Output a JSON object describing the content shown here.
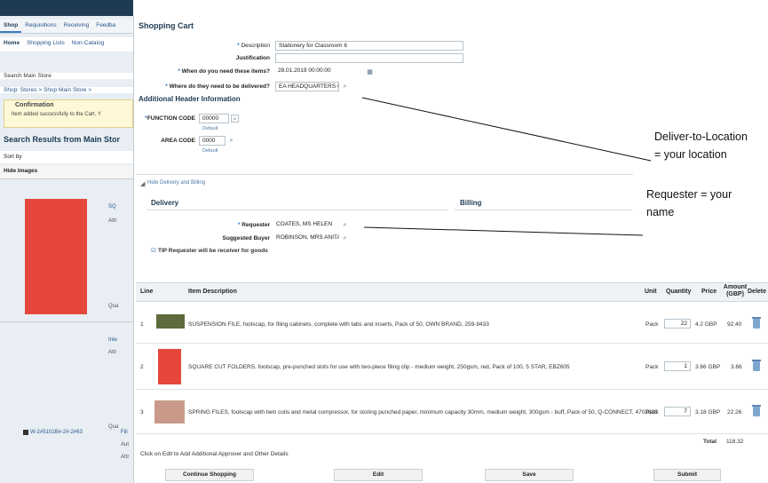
{
  "background": {
    "tabs": [
      "Shop",
      "Requisitions",
      "Receiving",
      "Feedba"
    ],
    "subtabs": [
      "Home",
      "Shopping Lists",
      "Non-Catalog"
    ],
    "search_line": "Search   Main Store",
    "breadcrumb": "Shop: Stores >  Shop Main Store >",
    "confirmation_title": "Confirmation",
    "confirmation_msg": "Item added successfully to the Cart. Y",
    "search_results_title": "Search Results from Main Stor",
    "sort_label": "Sort by",
    "hide_images": "Hide Images",
    "product_text_1": "SQ",
    "product_text_2": "Attr",
    "qual_1": "Qua",
    "product2_text_1": "Inte",
    "product2_text_2": "Attr",
    "qual_2": "Qua",
    "bottom_item": "W-2#5101B#-2#-2#63",
    "bottom_side_1": "Fili",
    "bottom_side_2": "Aut",
    "bottom_side_3": "Attr"
  },
  "cart": {
    "title": "Shopping Cart",
    "description_label": "Description",
    "description_value": "Stationery for Classroom 6",
    "justification_label": "Justification",
    "justification_value": "",
    "need_label": "When do you need these items?",
    "need_value": "28.01.2019 00:00:00",
    "deliver_label": "Where do they need to be delivered?",
    "deliver_value": "EA HEADQUARTERS QI",
    "additional_header": "Additional Header Information",
    "function_code_label": "FUNCTION CODE",
    "function_code_value": "00000",
    "function_default": "Default",
    "area_code_label": "AREA CODE",
    "area_code_value": "0000",
    "area_default": "Default",
    "hide_delivery_link": "Hide Delivery and Billing",
    "delivery_title": "Delivery",
    "billing_title": "Billing",
    "requester_label": "Requester",
    "requester_value": "COATES, MS HELEN",
    "buyer_label": "Suggested Buyer",
    "buyer_value": "ROBINSON, MRS ANITA",
    "tip_text": "TIP Requester will be receiver for goods"
  },
  "table": {
    "headers": {
      "line": "Line",
      "desc": "Item Description",
      "unit": "Unit",
      "qty": "Quantity",
      "price": "Price",
      "amount": "Amount (GBP)",
      "delete": "Delete"
    },
    "rows": [
      {
        "line": "1",
        "desc": "SUSPENSION FILE, foolscap, for filing cabinets, complete with tabs and inserts, Pack of 50, OWN BRAND, 259-9433",
        "unit": "Pack",
        "qty": "22",
        "price": "4.2 GBP",
        "amount": "92.40",
        "thumb_color": "#5d6b3c"
      },
      {
        "line": "2",
        "desc": "SQUARE CUT FOLDERS, foolscap, pre-punched slots for use with two-piece filing clip - medium weight, 250gsm, red, Pack of 100, 5 STAR, EBZ605",
        "unit": "Pack",
        "qty": "1",
        "price": "3.66 GBP",
        "amount": "3.66",
        "thumb_color": "#e6473c"
      },
      {
        "line": "3",
        "desc": "SPRING FILES, foolscap with twin coils and metal compressor, for storing punched paper, minimum capacity 30mm, medium weight, 300gsm - buff, Pack of 50, Q-CONNECT, 4702600",
        "unit": "Pack",
        "qty": "7",
        "price": "3.18 GBP",
        "amount": "22.26",
        "thumb_color": "#c99a8a"
      }
    ],
    "total_label": "Total",
    "total_value": "118.32"
  },
  "footer": {
    "edit_note": "Click on Edit to Add Additional Approver and Other Details",
    "continue": "Continue Shopping",
    "edit": "Edit",
    "save": "Save",
    "submit": "Submit"
  },
  "annotation": {
    "line1": "Deliver-to-Location",
    "line2": "= your location",
    "line3": "Requester = your",
    "line4": "name"
  },
  "colors": {
    "accent": "#1f3b53",
    "link": "#28568a",
    "required": "#2d6db3"
  }
}
